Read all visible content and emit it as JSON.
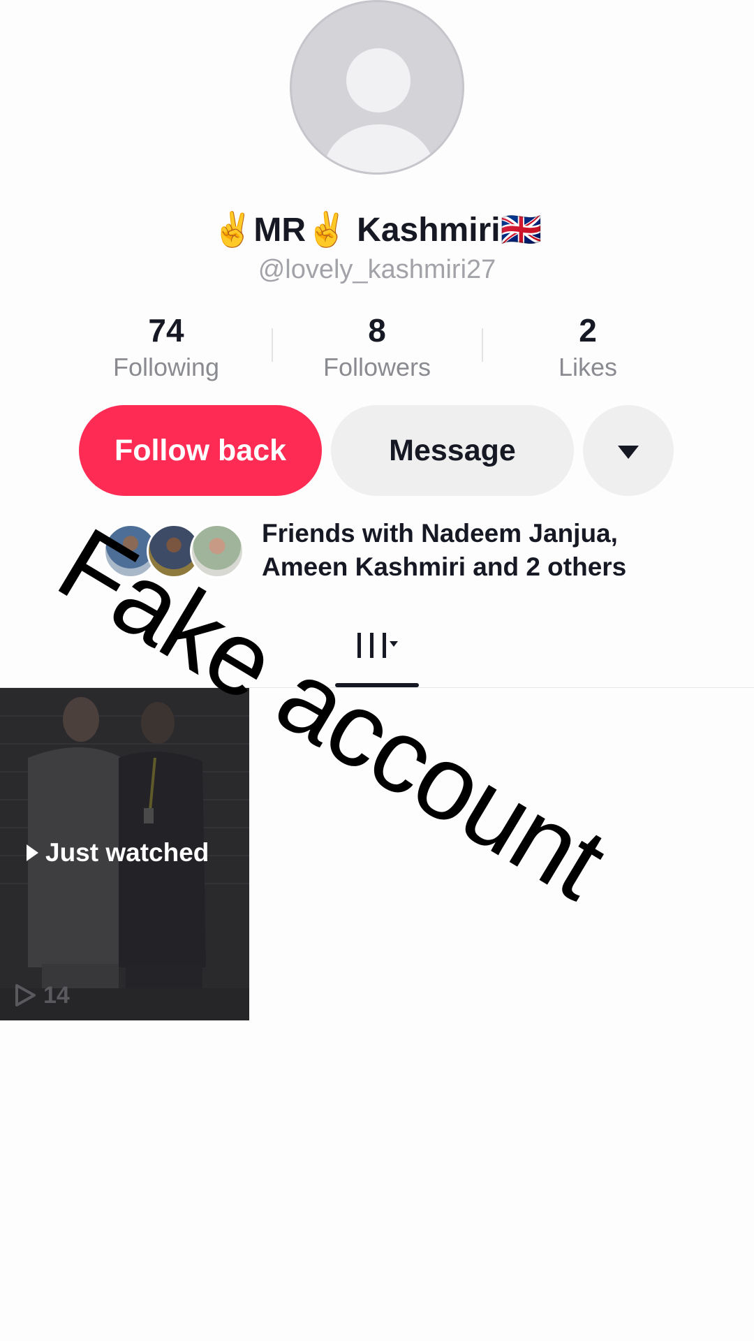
{
  "profile": {
    "display_name": "✌️MR✌️ Kashmiri🇬🇧",
    "username": "@lovely_kashmiri27"
  },
  "stats": [
    {
      "value": "74",
      "label": "Following"
    },
    {
      "value": "8",
      "label": "Followers"
    },
    {
      "value": "2",
      "label": "Likes"
    }
  ],
  "actions": {
    "follow_back": "Follow back",
    "message": "Message"
  },
  "friends": {
    "line1": "Friends with Nadeem Janjua,",
    "line2": "Ameen Kashmiri and 2 others"
  },
  "video": {
    "badge": "Just watched",
    "views": "14"
  },
  "overlay": {
    "text": "Fake account"
  },
  "icons": {
    "avatar": "default-avatar-icon",
    "more": "caret-down-icon",
    "tab": "grid-icon",
    "views": "play-outline-icon"
  },
  "colors": {
    "follow_button": "#fe2c55",
    "secondary_button": "#efeff0"
  }
}
